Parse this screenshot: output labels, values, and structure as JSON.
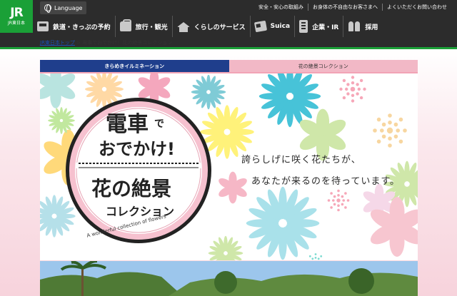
{
  "header": {
    "logo_text": "JR",
    "logo_sub": "JR東日本",
    "language_label": "Language",
    "top_links": [
      "安全・安心の取組み",
      "お身体の不自由なお客さまへ",
      "よくいただくお問い合わせ"
    ],
    "nav": [
      {
        "label": "鉄道・きっぷの予約",
        "icon": "train-icon"
      },
      {
        "label": "旅行・観光",
        "icon": "suitcase-icon"
      },
      {
        "label": "くらしのサービス",
        "icon": "house-icon"
      },
      {
        "label": "Suica",
        "icon": "card-icon"
      },
      {
        "label": "企業・IR",
        "icon": "building-icon"
      },
      {
        "label": "採用",
        "icon": "people-icon"
      }
    ]
  },
  "breadcrumb": {
    "home": "JR東日本トップ",
    "separator": ">",
    "current": "電車でおでかけ！花の絶景コレクション"
  },
  "tabs": [
    {
      "label": "きらめきイルミネーション",
      "active": true
    },
    {
      "label": "花の絶景コレクション",
      "active": false
    }
  ],
  "hero": {
    "badge_line1": "電車",
    "badge_de": "で",
    "badge_line2": "おでかけ!",
    "badge_title": "花の絶景",
    "badge_sub": "コレクション",
    "badge_english": "A wonderful collection of flowers",
    "tagline1": "誇らしげに咲く花たちが、",
    "tagline2": "あなたが来るのを待っています。"
  },
  "colors": {
    "brand_green": "#1aa037",
    "header_dark": "#2c2c2c",
    "tab_active": "#1f3e8c",
    "tab_inactive": "#f2b8c6"
  }
}
